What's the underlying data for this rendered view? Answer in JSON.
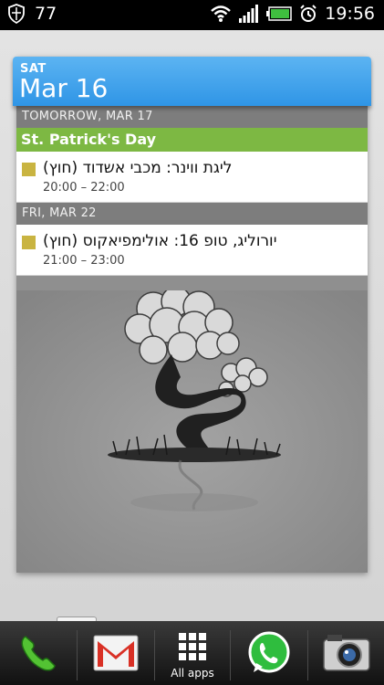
{
  "statusbar": {
    "notification_count": "77",
    "time": "19:56",
    "icons": [
      "shield-icon",
      "wifi-icon",
      "signal-icon",
      "battery-icon",
      "alarm-icon"
    ]
  },
  "widget": {
    "header": {
      "day_of_week": "SAT",
      "date": "Mar 16"
    },
    "sections": [
      {
        "day_label": "TOMORROW, MAR 17",
        "holiday": "St. Patrick's Day",
        "events": [
          {
            "title": "ליגת ווינר: מכבי אשדוד (חוץ)",
            "time": "20:00 – 22:00",
            "color": "#c9b441"
          }
        ]
      },
      {
        "day_label": "FRI, MAR 22",
        "events": [
          {
            "title": "יורוליג, טופ 16: אולימפיאקוס (חוץ)",
            "time": "21:00 – 23:00",
            "color": "#c9b441"
          }
        ]
      }
    ]
  },
  "dock": {
    "items": [
      "phone-icon",
      "gmail-icon",
      "all-apps-icon",
      "whatsapp-icon",
      "camera-icon"
    ],
    "all_apps_label": "All apps"
  },
  "colors": {
    "header_blue": "#3a9fea",
    "holiday_green": "#7db843",
    "event_chip": "#c9b441"
  }
}
